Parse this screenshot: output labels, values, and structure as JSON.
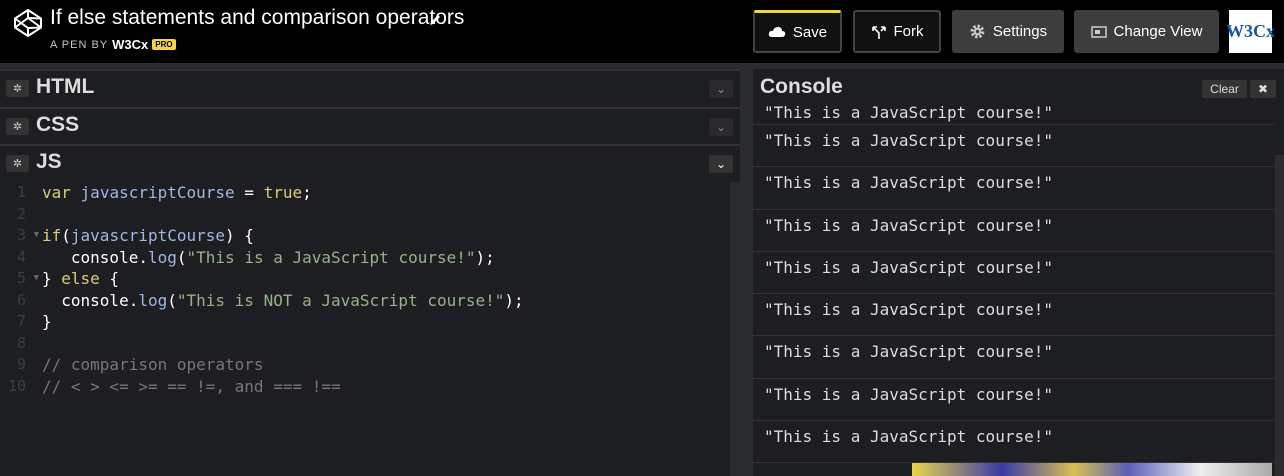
{
  "header": {
    "title": "If else statements and comparison operators",
    "byline_prefix": "A PEN BY",
    "author": "W3Cx",
    "pro_badge": "PRO",
    "avatar_text": "W3Cx"
  },
  "toolbar": {
    "save_label": "Save",
    "fork_label": "Fork",
    "settings_label": "Settings",
    "change_view_label": "Change View"
  },
  "panels": {
    "html_label": "HTML",
    "css_label": "CSS",
    "js_label": "JS"
  },
  "editor": {
    "line_numbers": [
      "1",
      "2",
      "3",
      "4",
      "5",
      "6",
      "7",
      "8",
      "9",
      "10"
    ],
    "lines": [
      [
        {
          "t": "var",
          "c": "kw"
        },
        {
          "t": " ",
          "c": ""
        },
        {
          "t": "javascriptCourse",
          "c": "var"
        },
        {
          "t": " = ",
          "c": ""
        },
        {
          "t": "true",
          "c": "bool"
        },
        {
          "t": ";",
          "c": ""
        }
      ],
      [],
      [
        {
          "t": "if",
          "c": "kw"
        },
        {
          "t": "(",
          "c": ""
        },
        {
          "t": "javascriptCourse",
          "c": "var"
        },
        {
          "t": ") {",
          "c": ""
        }
      ],
      [
        {
          "t": "   console.",
          "c": ""
        },
        {
          "t": "log",
          "c": "fn"
        },
        {
          "t": "(",
          "c": ""
        },
        {
          "t": "\"This is a JavaScript course!\"",
          "c": "str"
        },
        {
          "t": ");",
          "c": ""
        }
      ],
      [
        {
          "t": "} ",
          "c": ""
        },
        {
          "t": "else",
          "c": "kw"
        },
        {
          "t": " {",
          "c": ""
        }
      ],
      [
        {
          "t": "  console.",
          "c": ""
        },
        {
          "t": "log",
          "c": "fn"
        },
        {
          "t": "(",
          "c": ""
        },
        {
          "t": "\"This is NOT a JavaScript course!\"",
          "c": "str"
        },
        {
          "t": ");",
          "c": ""
        }
      ],
      [
        {
          "t": "}",
          "c": ""
        }
      ],
      [],
      [
        {
          "t": "// comparison operators",
          "c": "cm"
        }
      ],
      [
        {
          "t": "// < > <= >= == !=, and === !==",
          "c": "cm"
        }
      ]
    ]
  },
  "console": {
    "title": "Console",
    "clear_label": "Clear",
    "close_symbol": "✖",
    "entries": [
      "\"This is a JavaScript course!\"",
      "\"This is a JavaScript course!\"",
      "\"This is a JavaScript course!\"",
      "\"This is a JavaScript course!\"",
      "\"This is a JavaScript course!\"",
      "\"This is a JavaScript course!\"",
      "\"This is a JavaScript course!\"",
      "\"This is a JavaScript course!\"",
      "\"This is a JavaScript course!\""
    ]
  },
  "colors": {
    "accent": "#f5d547",
    "background": "#1d1e22",
    "topbar": "#000000"
  }
}
